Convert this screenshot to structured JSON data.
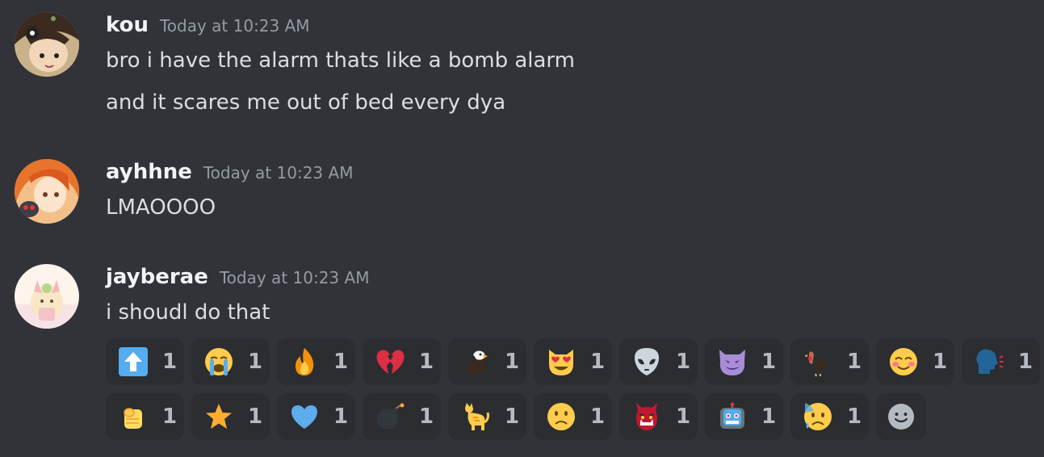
{
  "messages": [
    {
      "author": "kou",
      "timestamp": "Today at 10:23 AM",
      "lines": [
        "bro i have the alarm thats like a bomb alarm",
        "and it scares me out of bed every dya"
      ]
    },
    {
      "author": "ayhhne",
      "timestamp": "Today at 10:23 AM",
      "lines": [
        "LMAOOOO"
      ]
    },
    {
      "author": "jayberae",
      "timestamp": "Today at 10:23 AM",
      "lines": [
        "i shoudl do that"
      ]
    }
  ],
  "reactions": [
    {
      "emoji": "arrow-up-icon",
      "count": "1"
    },
    {
      "emoji": "loudly-crying-face-icon",
      "count": "1"
    },
    {
      "emoji": "fire-icon",
      "count": "1"
    },
    {
      "emoji": "broken-heart-icon",
      "count": "1"
    },
    {
      "emoji": "eagle-icon",
      "count": "1"
    },
    {
      "emoji": "heart-eyes-cat-icon",
      "count": "1"
    },
    {
      "emoji": "alien-icon",
      "count": "1"
    },
    {
      "emoji": "smiling-imp-icon",
      "count": "1"
    },
    {
      "emoji": "turkey-icon",
      "count": "1"
    },
    {
      "emoji": "blush-icon",
      "count": "1"
    },
    {
      "emoji": "speaking-head-icon",
      "count": "1"
    },
    {
      "emoji": "point-at-viewer-icon",
      "count": "1"
    },
    {
      "emoji": "star-icon",
      "count": "1"
    },
    {
      "emoji": "blue-heart-icon",
      "count": "1"
    },
    {
      "emoji": "bomb-icon",
      "count": "1"
    },
    {
      "emoji": "cat-icon",
      "count": "1"
    },
    {
      "emoji": "slightly-frowning-face-icon",
      "count": "1"
    },
    {
      "emoji": "ogre-icon",
      "count": "1"
    },
    {
      "emoji": "robot-icon",
      "count": "1"
    },
    {
      "emoji": "anxious-sweat-face-icon",
      "count": "1"
    }
  ],
  "add_reaction": {
    "icon": "add-reaction-smiley-icon"
  },
  "colors": {
    "background": "#313338",
    "reaction_bg": "#2b2d31",
    "username": "#f2f3f5",
    "timestamp": "#949ba4",
    "text": "#dbdee1"
  }
}
